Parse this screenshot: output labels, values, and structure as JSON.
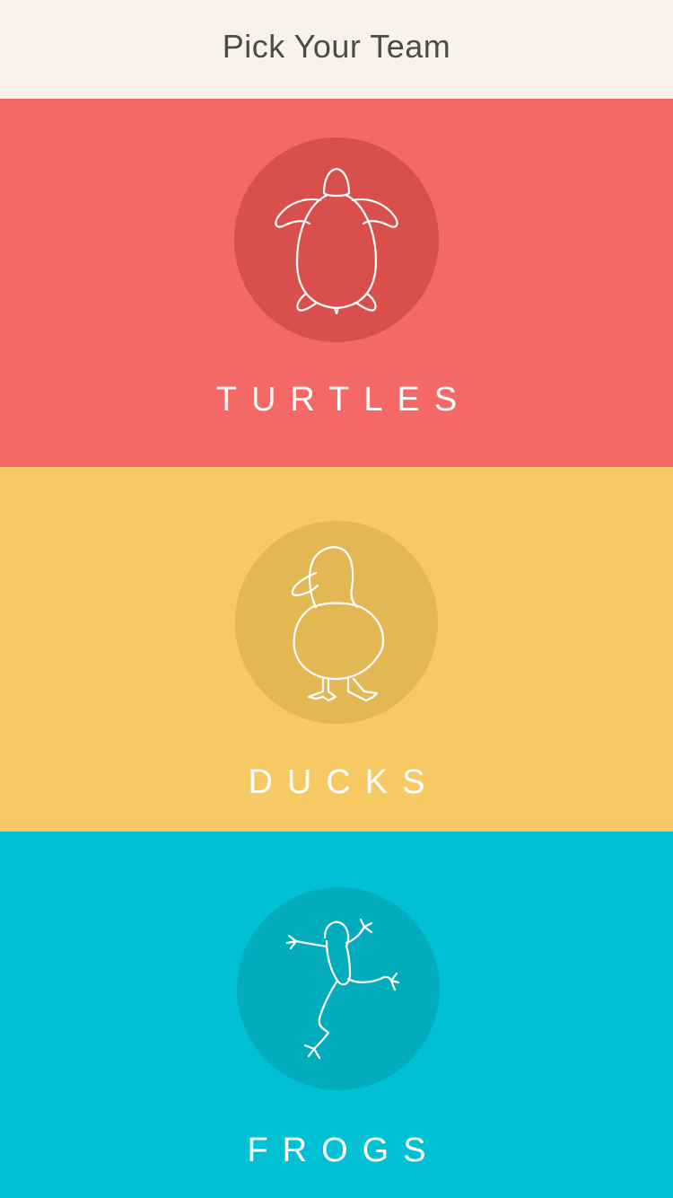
{
  "header": {
    "title": "Pick Your Team"
  },
  "teams": [
    {
      "label": "TURTLES",
      "icon": "turtle-icon",
      "background": "#f46866",
      "badge": "#d84f4c"
    },
    {
      "label": "DUCKS",
      "icon": "duck-icon",
      "background": "#f7c964",
      "badge": "#e3b754"
    },
    {
      "label": "FROGS",
      "icon": "frog-icon",
      "background": "#00c1d4",
      "badge": "#02acbd"
    }
  ]
}
